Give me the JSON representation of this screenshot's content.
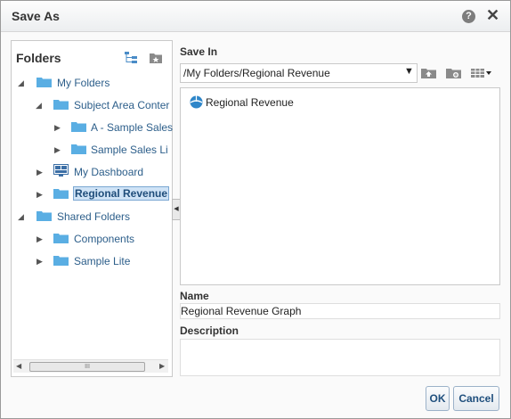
{
  "dialog": {
    "title": "Save As",
    "help_glyph": "?",
    "close_glyph": "✕"
  },
  "folders": {
    "title": "Folders",
    "tree": [
      {
        "label": "My Folders",
        "expanded": true
      },
      {
        "label": "Subject Area Conter",
        "expanded": true
      },
      {
        "label": "A - Sample Sales",
        "expanded": false
      },
      {
        "label": "Sample Sales Li",
        "expanded": false
      },
      {
        "label": "My Dashboard",
        "expanded": false
      },
      {
        "label": "Regional Revenue",
        "expanded": false,
        "selected": true
      },
      {
        "label": "Shared Folders",
        "expanded": true
      },
      {
        "label": "Components",
        "expanded": false
      },
      {
        "label": "Sample Lite",
        "expanded": false
      }
    ],
    "scroll_thumb_glyph": "III"
  },
  "save_in": {
    "label": "Save In",
    "path": "/My Folders/Regional Revenue",
    "items": [
      {
        "label": "Regional Revenue",
        "icon": "analysis-icon"
      }
    ]
  },
  "name": {
    "label": "Name",
    "value": "Regional Revenue Graph"
  },
  "description": {
    "label": "Description",
    "value": ""
  },
  "buttons": {
    "ok": "OK",
    "cancel": "Cancel"
  },
  "colors": {
    "link": "#2c5e8a",
    "folder": "#5aaee3",
    "selection_bg": "#cfe3f6"
  }
}
